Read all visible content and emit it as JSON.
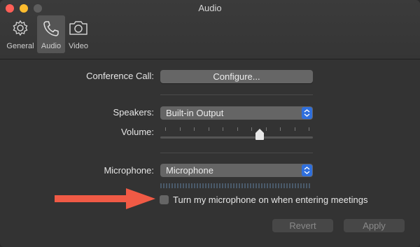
{
  "window": {
    "title": "Audio"
  },
  "tabs": [
    {
      "label": "General",
      "icon": "gear-icon"
    },
    {
      "label": "Audio",
      "icon": "phone-icon"
    },
    {
      "label": "Video",
      "icon": "camera-icon"
    }
  ],
  "conference": {
    "label": "Conference Call:",
    "button": "Configure..."
  },
  "speakers": {
    "label": "Speakers:",
    "selected": "Built-in Output"
  },
  "volume": {
    "label": "Volume:",
    "level": 0.65
  },
  "microphone": {
    "label": "Microphone:",
    "selected": "Microphone"
  },
  "mic_toggle": {
    "label": "Turn my microphone on when entering meetings",
    "checked": false
  },
  "actions": {
    "revert": "Revert",
    "apply": "Apply"
  },
  "colors": {
    "accent": "#2f6fdc",
    "arrow": "#f05a45"
  }
}
